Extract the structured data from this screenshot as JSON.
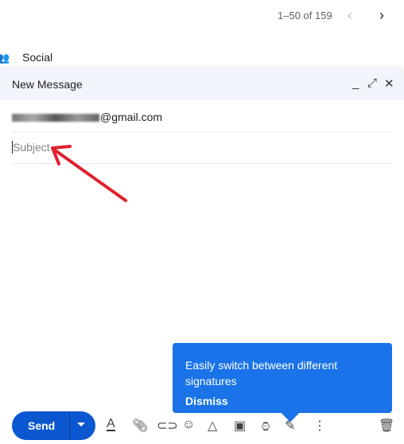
{
  "pager": {
    "range": "1–50 of 159",
    "prev_icon": "chevron-left-icon",
    "next_icon": "chevron-right-icon"
  },
  "category": {
    "label": "Social",
    "icon": "people-icon"
  },
  "compose": {
    "title": "New Message",
    "to_visible": "gmail.com",
    "subject_placeholder": "Subject",
    "send_label": "Send"
  },
  "tooltip": {
    "message": "Easily switch between different signatures",
    "dismiss": "Dismiss",
    "color": "#1a73e8"
  },
  "annotation": {
    "arrow_color": "#e0212e"
  },
  "toolbar": [
    "formatting-icon",
    "attach-icon",
    "link-icon",
    "emoji-icon",
    "drive-icon",
    "photo-icon",
    "schedule-icon",
    "signature-icon",
    "more-icon",
    "trash-icon"
  ]
}
